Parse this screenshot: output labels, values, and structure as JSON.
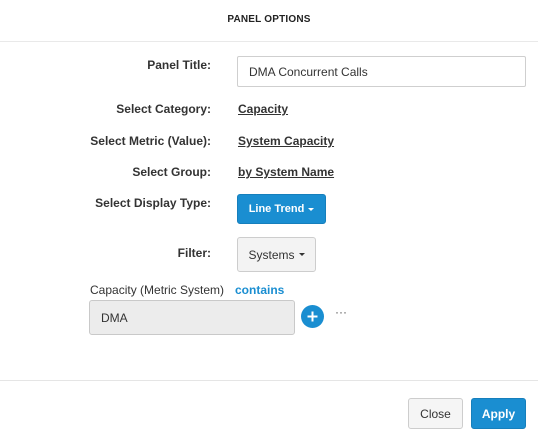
{
  "modal": {
    "title": "PANEL OPTIONS"
  },
  "form": {
    "panel_title_label": "Panel Title:",
    "panel_title_value": "DMA Concurrent Calls",
    "category_label": "Select Category:",
    "category_value": "Capacity",
    "metric_label": "Select Metric (Value):",
    "metric_value": "System Capacity",
    "group_label": "Select Group:",
    "group_value": "by System Name",
    "display_type_label": "Select Display Type:",
    "display_type_value": "Line Trend",
    "filter_label": "Filter:",
    "filter_dropdown_value": "Systems"
  },
  "filter_row": {
    "field_label": "Capacity (Metric System)",
    "operator": "contains",
    "value": "DMA",
    "add_icon": "plus-circle-icon",
    "more_icon": "ellipsis-icon",
    "more_text": "···"
  },
  "footer": {
    "close_label": "Close",
    "apply_label": "Apply"
  },
  "colors": {
    "accent": "#1a8ed1",
    "filter_box_bg": "#ececec"
  }
}
